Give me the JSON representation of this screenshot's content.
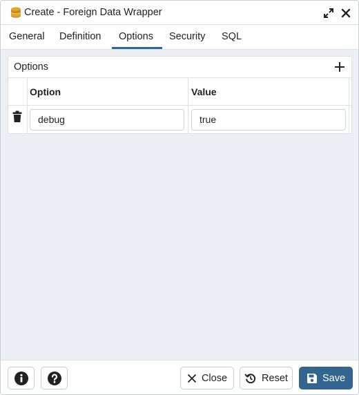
{
  "window": {
    "title": "Create - Foreign Data Wrapper",
    "icon": "database-icon"
  },
  "tabs": [
    {
      "label": "General",
      "active": false
    },
    {
      "label": "Definition",
      "active": false
    },
    {
      "label": "Options",
      "active": true
    },
    {
      "label": "Security",
      "active": false
    },
    {
      "label": "SQL",
      "active": false
    }
  ],
  "options_panel": {
    "title": "Options",
    "columns": [
      "Option",
      "Value"
    ],
    "rows": [
      {
        "option": "debug",
        "value": "true"
      }
    ]
  },
  "footer": {
    "info_icon": "info-icon",
    "help_icon": "help-icon",
    "close_label": "Close",
    "reset_label": "Reset",
    "save_label": "Save"
  },
  "colors": {
    "accent": "#326690",
    "background": "#ebeef3",
    "border": "#dde0e6"
  }
}
